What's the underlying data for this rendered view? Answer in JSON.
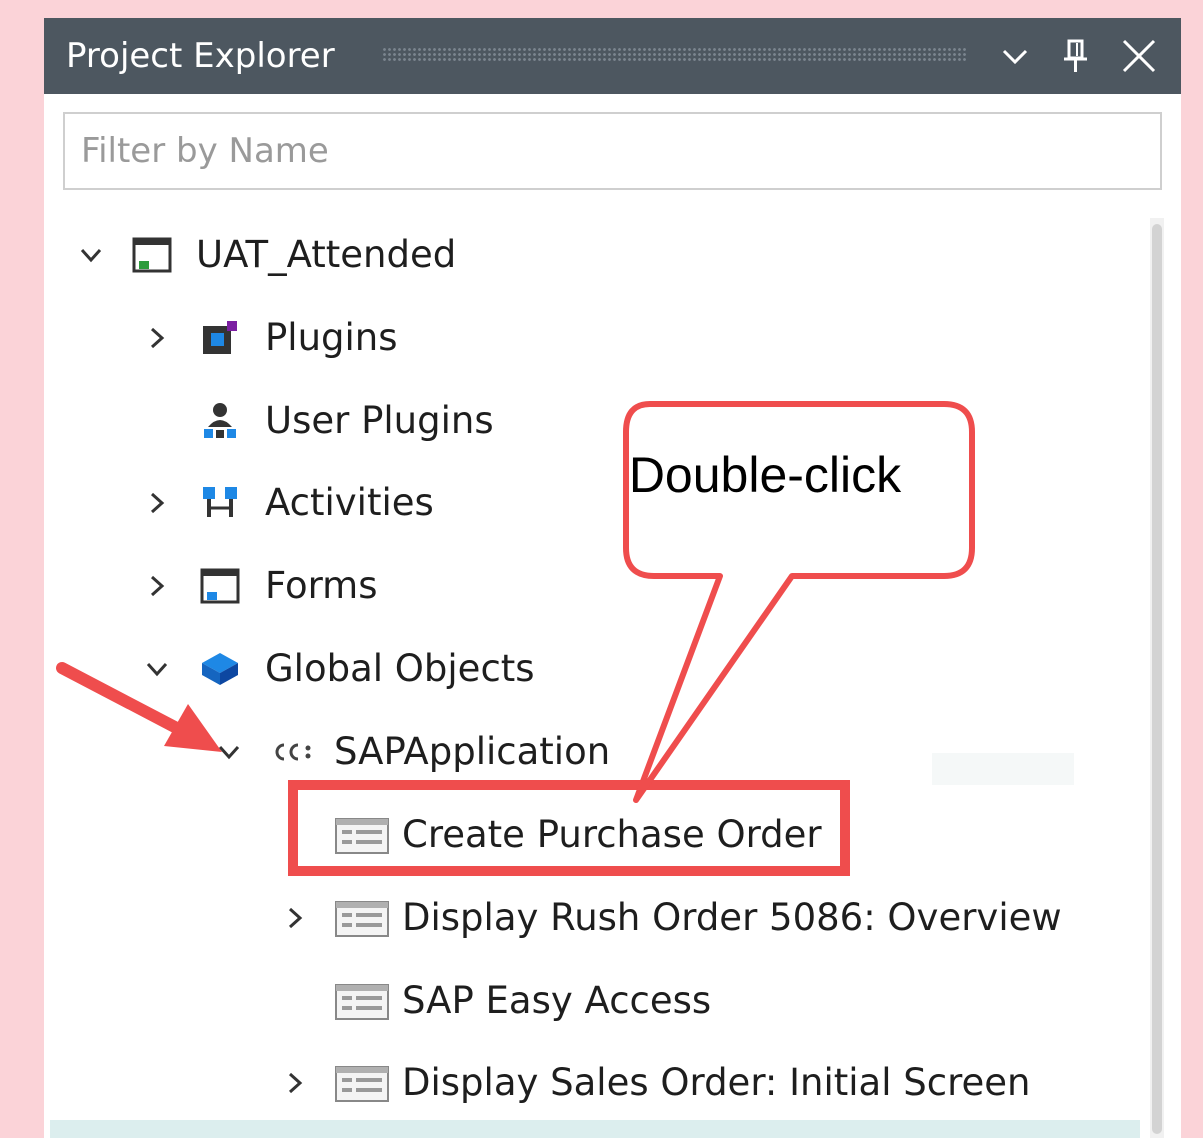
{
  "panel": {
    "title": "Project Explorer",
    "icons": [
      "chevron-down-icon",
      "pin-icon",
      "close-icon"
    ]
  },
  "filter": {
    "placeholder": "Filter by Name",
    "value": ""
  },
  "tree": {
    "root": {
      "label": "UAT_Attended",
      "expanded": true,
      "icon": "project-form-icon"
    },
    "items": [
      {
        "label": "Plugins",
        "expandable": true,
        "expanded": false,
        "icon": "plugins-icon"
      },
      {
        "label": "User Plugins",
        "expandable": false,
        "icon": "user-plugins-icon"
      },
      {
        "label": "Activities",
        "expandable": true,
        "expanded": false,
        "icon": "activities-icon"
      },
      {
        "label": "Forms",
        "expandable": true,
        "expanded": false,
        "icon": "forms-icon"
      },
      {
        "label": "Global Objects",
        "expandable": true,
        "expanded": true,
        "icon": "global-objects-icon"
      },
      {
        "label": "SAPApplication",
        "expandable": true,
        "expanded": true,
        "icon": "sap-application-icon"
      },
      {
        "label": "Create Purchase Order",
        "expandable": false,
        "icon": "screen-icon",
        "highlighted": true
      },
      {
        "label": "Display Rush Order 5086: Overview",
        "expandable": true,
        "expanded": false,
        "icon": "screen-icon"
      },
      {
        "label": "SAP Easy Access",
        "expandable": false,
        "icon": "screen-icon"
      },
      {
        "label": "Display Sales Order: Initial Screen",
        "expandable": true,
        "expanded": false,
        "icon": "screen-icon"
      }
    ]
  },
  "annotation": {
    "callout_text": "Double-click",
    "accent_color": "#ef4d4d"
  },
  "colors": {
    "titlebar": "#4d5760",
    "background": "#fbd3d8"
  }
}
